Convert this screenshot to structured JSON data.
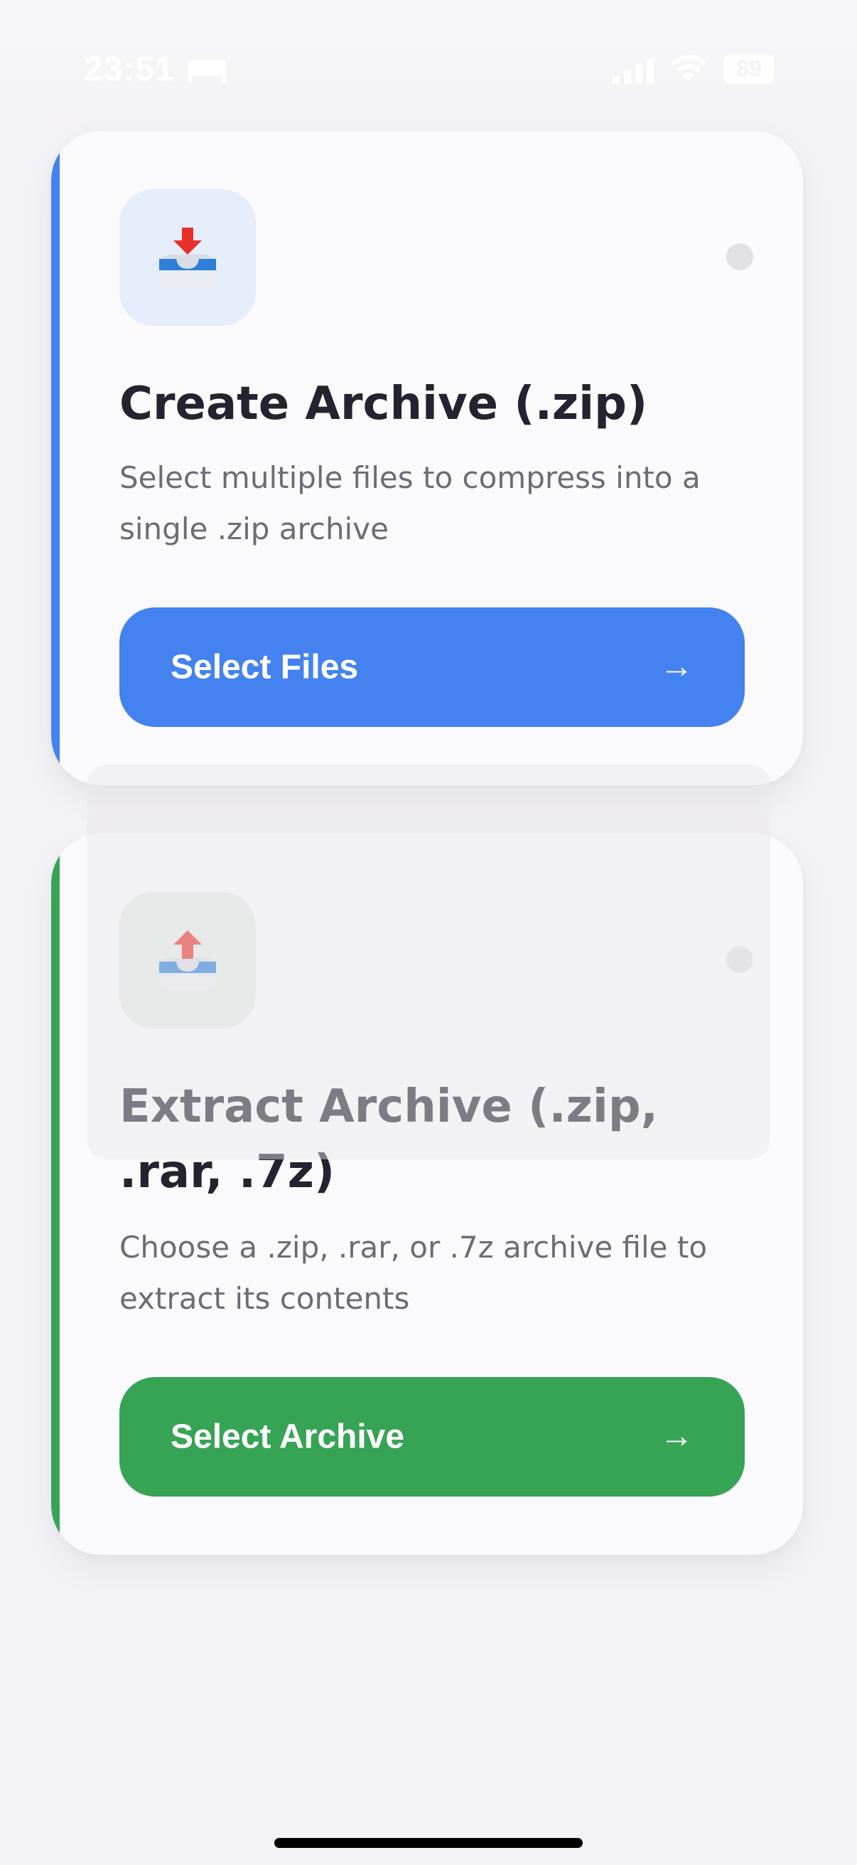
{
  "status_bar": {
    "time": "23:51",
    "battery": "89",
    "icons": [
      "bed-icon",
      "signal-icon",
      "wifi-icon",
      "battery-icon"
    ]
  },
  "cards": [
    {
      "id": "create",
      "icon": "inbox-download-icon",
      "title": "Create Archive (.zip)",
      "description": "Select multiple files to compress into a single .zip archive",
      "button_label": "Select Files",
      "button_arrow": "→",
      "accent_color": "#4482ef",
      "tile_color": "#e5ecfa"
    },
    {
      "id": "extract",
      "icon": "inbox-upload-icon",
      "title": "Extract Archive (.zip, .rar, .7z)",
      "description": "Choose a .zip, .rar, or .7z archive file to extract its contents",
      "button_label": "Select Archive",
      "button_arrow": "→",
      "accent_color": "#37a455",
      "tile_color": "#e3ebe5"
    }
  ]
}
